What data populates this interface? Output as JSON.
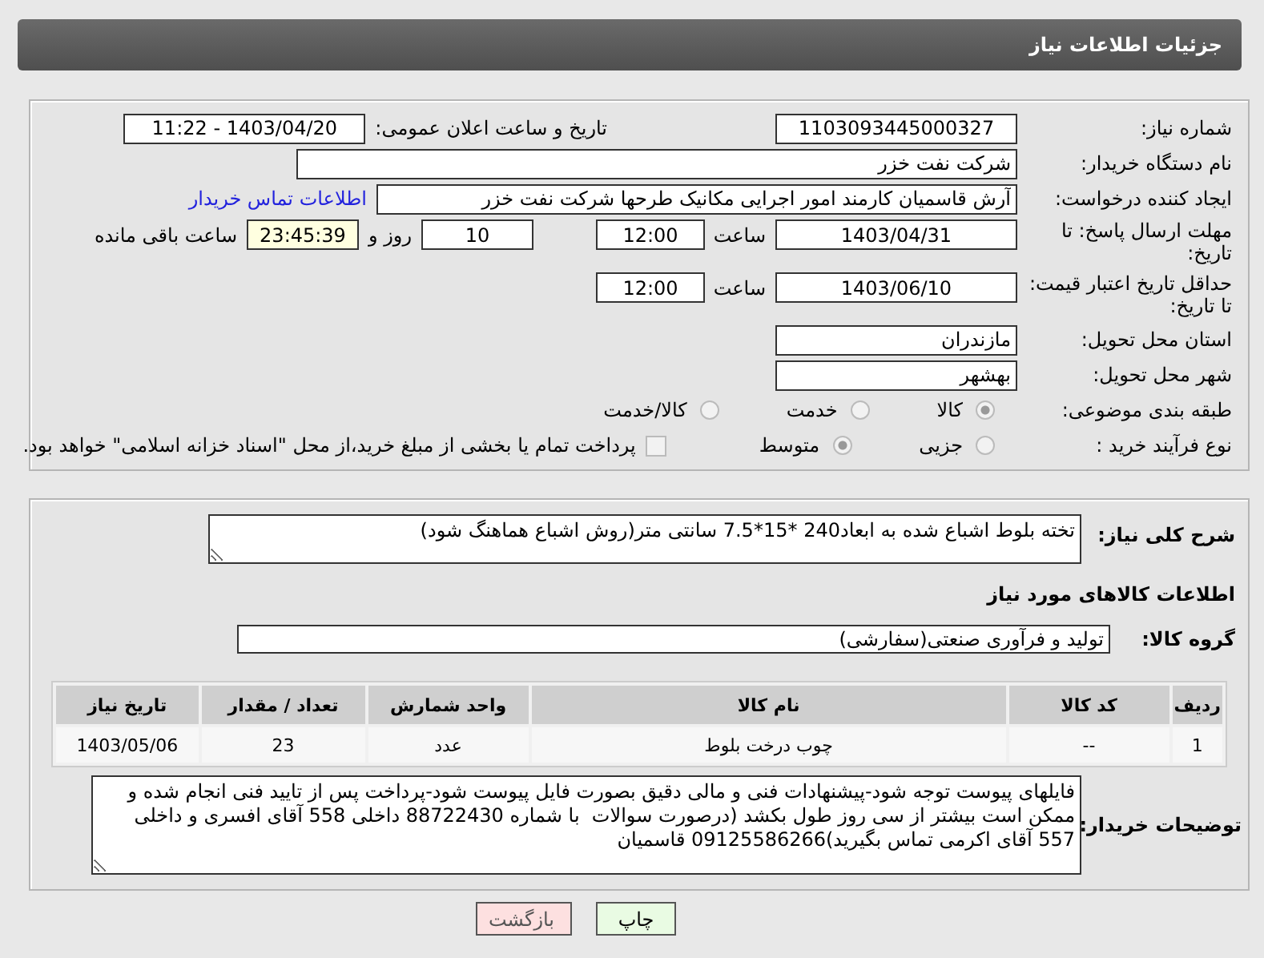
{
  "header": {
    "title": "جزئیات اطلاعات نیاز"
  },
  "need_number": {
    "label": "شماره نیاز:",
    "value": "1103093445000327"
  },
  "announce": {
    "label": "تاریخ و ساعت اعلان عمومی:",
    "value": "1403/04/20 - 11:22"
  },
  "buyer_org": {
    "label": "نام دستگاه خریدار:",
    "value": "شرکت نفت خزر"
  },
  "requester": {
    "label": "ایجاد کننده درخواست:",
    "value": "آرش قاسمیان کارمند امور اجرایی مکانیک طرحها شرکت نفت خزر",
    "contact_link": "اطلاعات تماس خریدار"
  },
  "reply_deadline": {
    "label": "مهلت ارسال پاسخ: تا تاریخ:",
    "date": "1403/04/31",
    "time_label": "ساعت",
    "time": "12:00",
    "days": "10",
    "days_label": "روز و",
    "remaining": "23:45:39",
    "remaining_label": "ساعت باقی مانده"
  },
  "price_validity": {
    "label": "حداقل تاریخ اعتبار قیمت: تا تاریخ:",
    "date": "1403/06/10",
    "time_label": "ساعت",
    "time": "12:00"
  },
  "province": {
    "label": "استان محل تحویل:",
    "value": "مازندران"
  },
  "city": {
    "label": "شهر محل تحویل:",
    "value": "بهشهر"
  },
  "category": {
    "label": "طبقه بندی موضوعی:",
    "options": [
      {
        "label": "کالا",
        "selected": true
      },
      {
        "label": "خدمت",
        "selected": false
      },
      {
        "label": "کالا/خدمت",
        "selected": false
      }
    ]
  },
  "purchase_type": {
    "label": "نوع فرآیند خرید :",
    "options": [
      {
        "label": "جزیی",
        "selected": false
      },
      {
        "label": "متوسط",
        "selected": true
      }
    ],
    "payment_option": {
      "label": "پرداخت تمام یا بخشی از مبلغ خرید،از محل \"اسناد خزانه اسلامی\" خواهد بود.",
      "checked": false
    }
  },
  "description": {
    "label": "شرح کلی نیاز:",
    "value": "تخته بلوط اشباع شده به ابعاد240 *15*7.5 سانتی متر(روش اشباع هماهنگ شود)"
  },
  "goods_heading": "اطلاعات کالاهای مورد نیاز",
  "goods_group": {
    "label": "گروه کالا:",
    "value": "تولید و فرآوری صنعتی(سفارشی)"
  },
  "items_table": {
    "columns": [
      "ردیف",
      "کد کالا",
      "نام کالا",
      "واحد شمارش",
      "تعداد / مقدار",
      "تاریخ نیاز"
    ],
    "rows": [
      [
        "1",
        "--",
        "چوب درخت بلوط",
        "عدد",
        "23",
        "1403/05/06"
      ]
    ]
  },
  "buyer_notes": {
    "label": "توضیحات خریدار:",
    "value": "فایلهای پیوست توجه شود-پیشنهادات فنی و مالی دقیق بصورت فایل پیوست شود-پرداخت پس از تایید فنی انجام شده و ممکن است بیشتر از سی روز طول بکشد (درصورت سوالات  با شماره 88722430 داخلی 558 آقای افسری و داخلی 557 آقای اکرمی تماس بگیرید)09125586266 قاسمیان"
  },
  "buttons": [
    {
      "label": "چاپ",
      "kind": "print"
    },
    {
      "label": "بازگشت",
      "kind": "back"
    }
  ]
}
